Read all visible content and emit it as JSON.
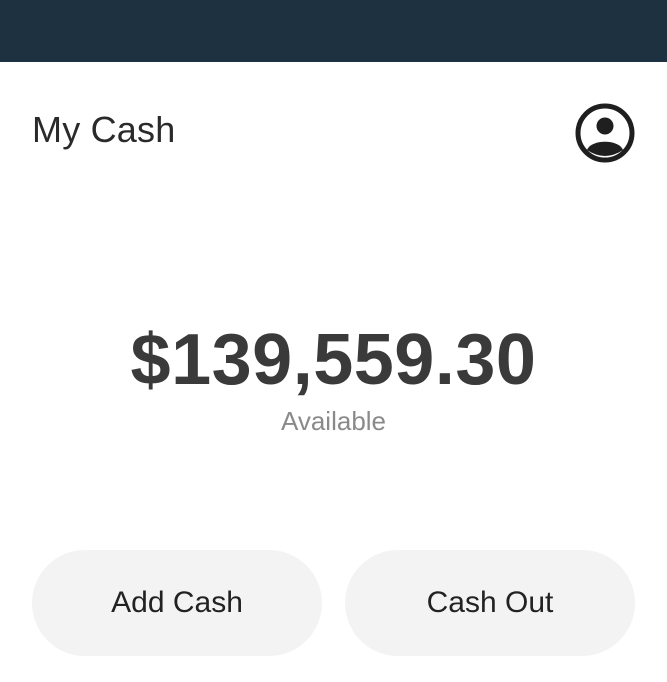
{
  "colors": {
    "top_bar": "#1e3140",
    "background": "#ffffff",
    "button_bg": "#f3f3f3",
    "amount_text": "#3a3a3a",
    "label_text": "#8a8a8a"
  },
  "header": {
    "title": "My Cash",
    "profile_icon": "user-circle-icon"
  },
  "balance": {
    "amount": "$139,559.30",
    "label": "Available"
  },
  "actions": {
    "add_cash_label": "Add Cash",
    "cash_out_label": "Cash Out"
  }
}
